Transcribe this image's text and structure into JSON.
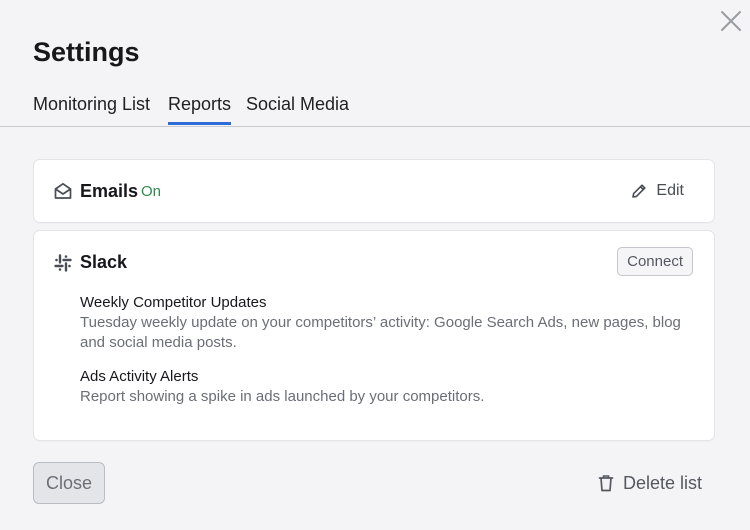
{
  "dialog": {
    "title": "Settings",
    "close_icon": "close-icon"
  },
  "tabs": [
    {
      "label": "Monitoring List",
      "active": false
    },
    {
      "label": "Reports",
      "active": true
    },
    {
      "label": "Social Media",
      "active": false
    }
  ],
  "emails": {
    "icon": "envelope-icon",
    "title": "Emails",
    "status": "On",
    "edit_icon": "pencil-icon",
    "edit_label": "Edit"
  },
  "slack": {
    "icon": "slack-icon",
    "title": "Slack",
    "connect_label": "Connect",
    "reports": [
      {
        "title": "Weekly Competitor Updates",
        "description": "Tuesday weekly update on your competitors’ activity: Google Search Ads, new pages, blog and social media posts."
      },
      {
        "title": "Ads Activity Alerts",
        "description": "Report showing a spike in ads launched by your competitors."
      }
    ]
  },
  "footer": {
    "close_label": "Close",
    "delete_icon": "trash-icon",
    "delete_label": "Delete list"
  },
  "colors": {
    "accent": "#2f6bd6",
    "status_on": "#2f8a4e",
    "background": "#f4f4f6",
    "card": "#ffffff"
  }
}
